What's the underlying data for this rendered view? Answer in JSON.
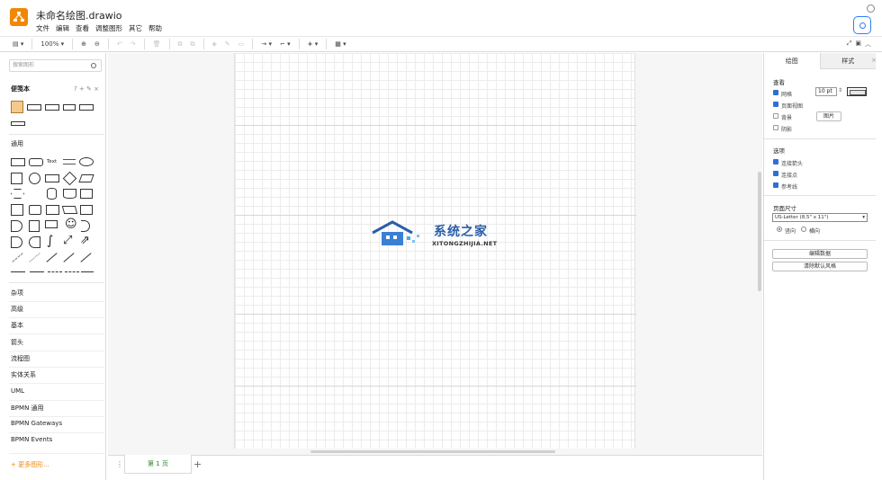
{
  "app": {
    "title": "未命名绘图.drawio"
  },
  "menu": [
    "文件",
    "编辑",
    "查看",
    "调整图形",
    "其它",
    "帮助"
  ],
  "toolbar": {
    "zoom": "100%"
  },
  "sidebar": {
    "search_placeholder": "搜索图形",
    "scratchpad": {
      "title": "便笺本",
      "tools": "? + ✎ ×"
    },
    "general_title": "通用",
    "general_shape_text": "Text",
    "categories": [
      "杂项",
      "高级",
      "基本",
      "箭头",
      "流程图",
      "实体关系",
      "UML",
      "BPMN 通用",
      "BPMN Gateways",
      "BPMN Events"
    ],
    "more_shapes": "+ 更多图形..."
  },
  "canvas": {
    "watermark_title": "系统之家",
    "watermark_sub": "XITONGZHIJIA.NET"
  },
  "bottom": {
    "page_tab": "第 1 页"
  },
  "panel": {
    "tabs": [
      "绘图",
      "样式"
    ],
    "view_title": "查看",
    "grid_label": "网格",
    "grid_size": "10 pt",
    "page_view_label": "页面视图",
    "background_label": "背景",
    "image_button": "图片",
    "shadow_label": "阴影",
    "options_title": "选项",
    "connection_arrows": "连接箭头",
    "connection_points": "连接点",
    "guides": "参考线",
    "page_size_title": "页面尺寸",
    "page_size_value": "US-Letter (8,5\" x 11\")",
    "portrait": "竖向",
    "landscape": "横向",
    "edit_data_button": "编辑数据",
    "clear_default_style_button": "清除默认风格"
  }
}
